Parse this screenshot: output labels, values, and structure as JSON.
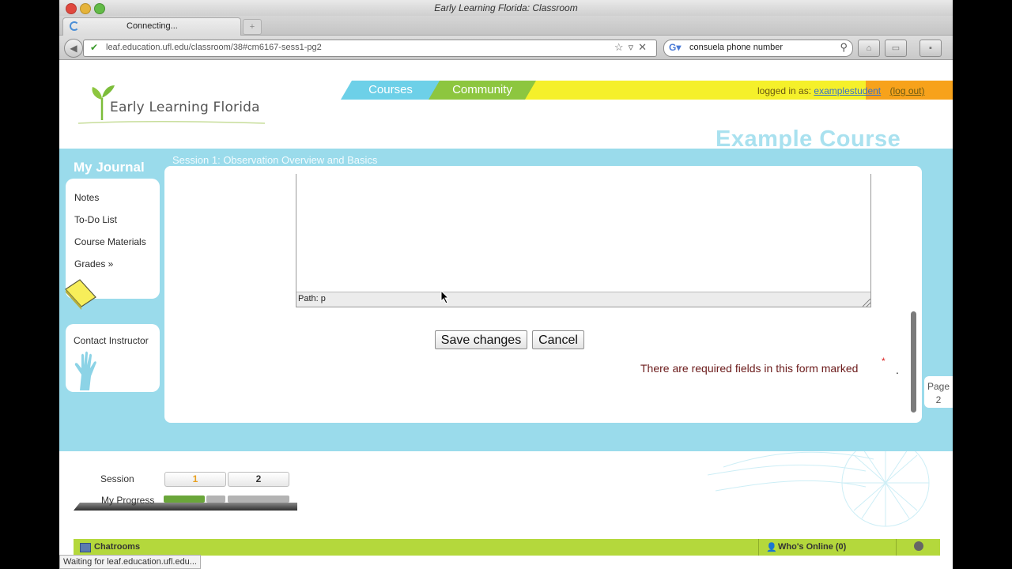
{
  "window": {
    "title": "Early Learning Florida: Classroom"
  },
  "tab": {
    "label": "Connecting..."
  },
  "address_bar": {
    "url": "leaf.education.ufl.edu/classroom/38#cm6167-sess1-pg2"
  },
  "search_bar": {
    "query": "consuela phone number"
  },
  "site": {
    "logo_text": "Early Learning Florida",
    "nav": {
      "courses": "Courses",
      "community": "Community"
    },
    "login": {
      "prefix": "logged in as:",
      "username": "examplestudent",
      "logout": "(log out)"
    },
    "course_title": "Example Course"
  },
  "sidebar": {
    "title": "My Journal",
    "items": [
      "Notes",
      "To-Do List",
      "Course Materials",
      "Grades »"
    ],
    "contact": "Contact Instructor"
  },
  "main": {
    "session_title": "Session 1: Observation Overview and Basics",
    "editor_path": "Path: p",
    "save_label": "Save changes",
    "cancel_label": "Cancel",
    "required_msg": "There are required fields in this form marked",
    "required_star": "*",
    "required_end": "."
  },
  "page_indicator": {
    "label": "Page",
    "number": "2"
  },
  "footer": {
    "session_label": "Session",
    "sessions": [
      "1",
      "2"
    ],
    "progress_label": "My Progress",
    "progress_fraction": 0.33,
    "chatrooms": "Chatrooms",
    "whos_online": "Who's Online (0)"
  },
  "status_bar": {
    "text": "Waiting for leaf.education.ufl.edu..."
  },
  "colors": {
    "blue_band": "#9adbeb",
    "courses_tab": "#6dd0e8",
    "community_tab": "#8dc63f",
    "nav_yellow": "#f5f02a",
    "nav_orange": "#f7a21b",
    "footer_green": "#b4d83c"
  }
}
